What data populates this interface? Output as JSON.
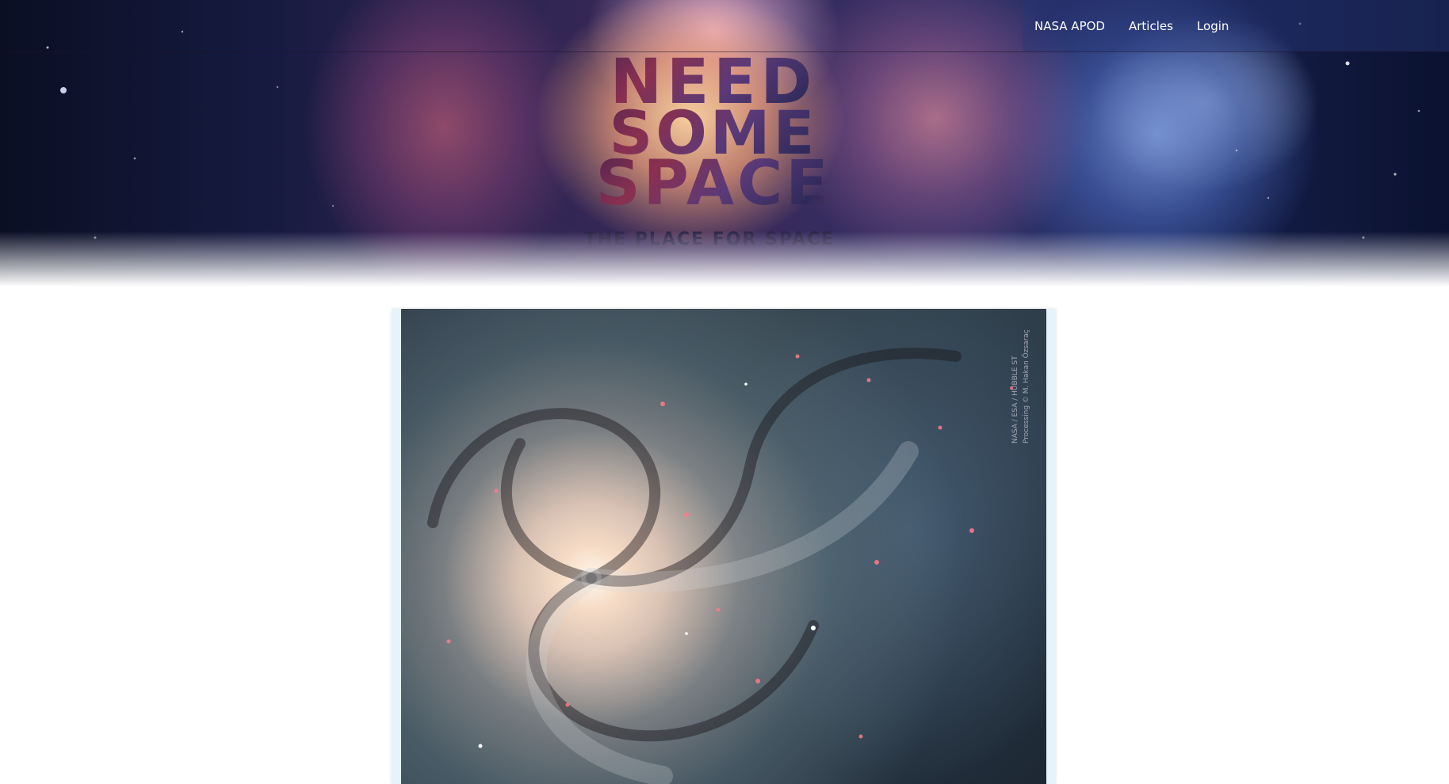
{
  "nav": {
    "links": [
      {
        "label": "NASA APOD"
      },
      {
        "label": "Articles"
      },
      {
        "label": "Login"
      }
    ]
  },
  "logo": {
    "lines": [
      "NEED",
      "SOME",
      "SPACE"
    ],
    "tagline": "THE PLACE FOR SPACE"
  },
  "apod": {
    "credit_lines": [
      "NASA / ESA / HUBBLE ST",
      "Processing © M. Hakan Özsaraç"
    ]
  },
  "colors": {
    "card_background": "#e6f3fb",
    "tagline": "#2a2346"
  }
}
